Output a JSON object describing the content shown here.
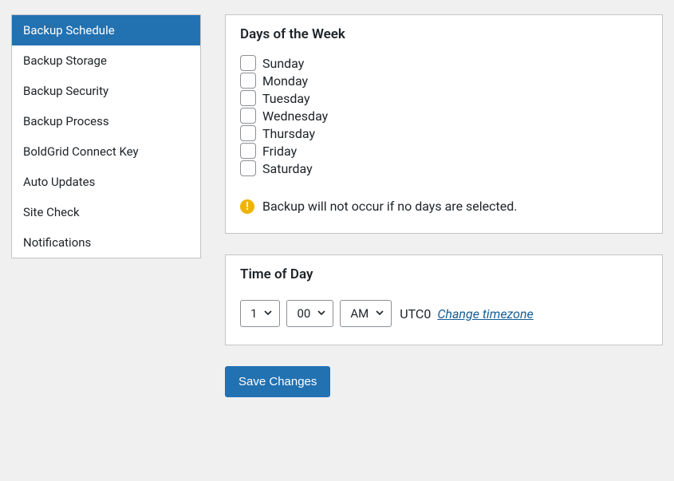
{
  "sidebar": {
    "items": [
      {
        "label": "Backup Schedule",
        "active": true
      },
      {
        "label": "Backup Storage",
        "active": false
      },
      {
        "label": "Backup Security",
        "active": false
      },
      {
        "label": "Backup Process",
        "active": false
      },
      {
        "label": "BoldGrid Connect Key",
        "active": false
      },
      {
        "label": "Auto Updates",
        "active": false
      },
      {
        "label": "Site Check",
        "active": false
      },
      {
        "label": "Notifications",
        "active": false
      }
    ]
  },
  "daysPanel": {
    "title": "Days of the Week",
    "days": [
      {
        "label": "Sunday",
        "checked": false
      },
      {
        "label": "Monday",
        "checked": false
      },
      {
        "label": "Tuesday",
        "checked": false
      },
      {
        "label": "Wednesday",
        "checked": false
      },
      {
        "label": "Thursday",
        "checked": false
      },
      {
        "label": "Friday",
        "checked": false
      },
      {
        "label": "Saturday",
        "checked": false
      }
    ],
    "warningText": "Backup will not occur if no days are selected."
  },
  "timePanel": {
    "title": "Time of Day",
    "hour": "1",
    "minute": "00",
    "ampm": "AM",
    "tzLabel": "UTC0",
    "tzLink": "Change timezone"
  },
  "saveLabel": "Save Changes"
}
